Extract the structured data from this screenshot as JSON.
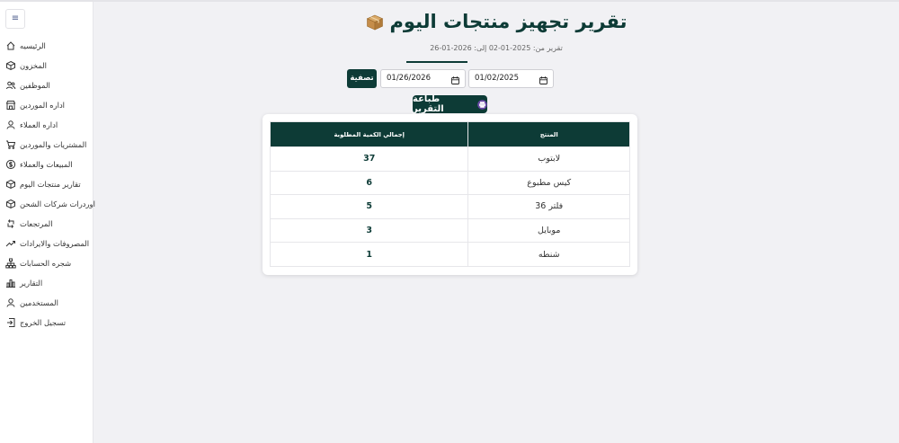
{
  "sidebar": {
    "menu_icon": "menu-icon",
    "items": [
      {
        "label": "الرئيسيه",
        "icon": "home-icon"
      },
      {
        "label": "المخزون",
        "icon": "box-icon"
      },
      {
        "label": "الموظفين",
        "icon": "users-icon"
      },
      {
        "label": "اداره الموردين",
        "icon": "store-icon"
      },
      {
        "label": "اداره العملاء",
        "icon": "user-icon"
      },
      {
        "label": "المشتريات والموردين",
        "icon": "cart-icon"
      },
      {
        "label": "المبيعات والعملاء",
        "icon": "dollar-icon"
      },
      {
        "label": "تقارير منتجات اليوم",
        "icon": "package-icon"
      },
      {
        "label": "اوردرات شركات الشحن",
        "icon": "box-icon"
      },
      {
        "label": "المرتجعات",
        "icon": "return-icon"
      },
      {
        "label": "المصروفات والايرادات",
        "icon": "trend-icon"
      },
      {
        "label": "شجره الحسابات",
        "icon": "sitemap-icon"
      },
      {
        "label": "التقارير",
        "icon": "chart-icon"
      },
      {
        "label": "المستخدمين",
        "icon": "user-icon"
      },
      {
        "label": "تسجيل الخروج",
        "icon": "logout-icon"
      }
    ]
  },
  "header": {
    "title": "تقرير تجهيز منتجات اليوم",
    "title_icon": "package-icon",
    "subtitle": "تقرير من: 2025-01-02 إلى: 2026-01-26"
  },
  "filters": {
    "date_from": "01/02/2025",
    "date_to": "01/26/2026",
    "filter_label": "تصفية",
    "print_label": "طباعة التقرير",
    "print_icon": "printer-icon"
  },
  "table": {
    "columns": [
      "المنتج",
      "إجمالي الكمية المطلوبة"
    ],
    "rows": [
      {
        "product": "لابتوب",
        "qty": "37"
      },
      {
        "product": "كيس مطبوع",
        "qty": "6"
      },
      {
        "product": "فلتر 36",
        "qty": "5"
      },
      {
        "product": "موبايل",
        "qty": "3"
      },
      {
        "product": "شنطه",
        "qty": "1"
      }
    ]
  },
  "colors": {
    "primary": "#0d3b36",
    "background": "#f1f1f4"
  }
}
